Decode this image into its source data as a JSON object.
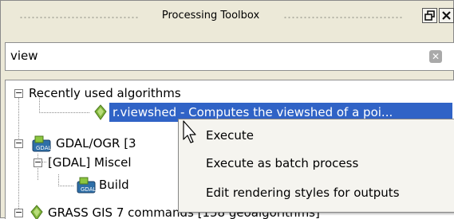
{
  "panel": {
    "title": "Processing Toolbox",
    "float_button_icon": "restore-icon",
    "close_button_icon": "close-icon"
  },
  "search": {
    "value": "view",
    "placeholder": "",
    "clear_icon": "clear-icon"
  },
  "tree": {
    "recent_group_label": "Recently used algorithms",
    "recent_item_label": "r.viewshed - Computes the viewshed of a poi...",
    "gdal_group_label": "GDAL/OGR [3",
    "gdal_misc_label": "[GDAL] Miscel",
    "gdal_build_label": "Build",
    "grass_group_label": "GRASS GIS 7 commands [158 geoalgorithms]"
  },
  "context_menu": {
    "items": [
      {
        "label": "Execute"
      },
      {
        "label": "Execute as batch process"
      },
      {
        "label": "Edit rendering styles for outputs"
      }
    ]
  },
  "colors": {
    "selection": "#3063c6",
    "panel_bg": "#ece9d8"
  }
}
